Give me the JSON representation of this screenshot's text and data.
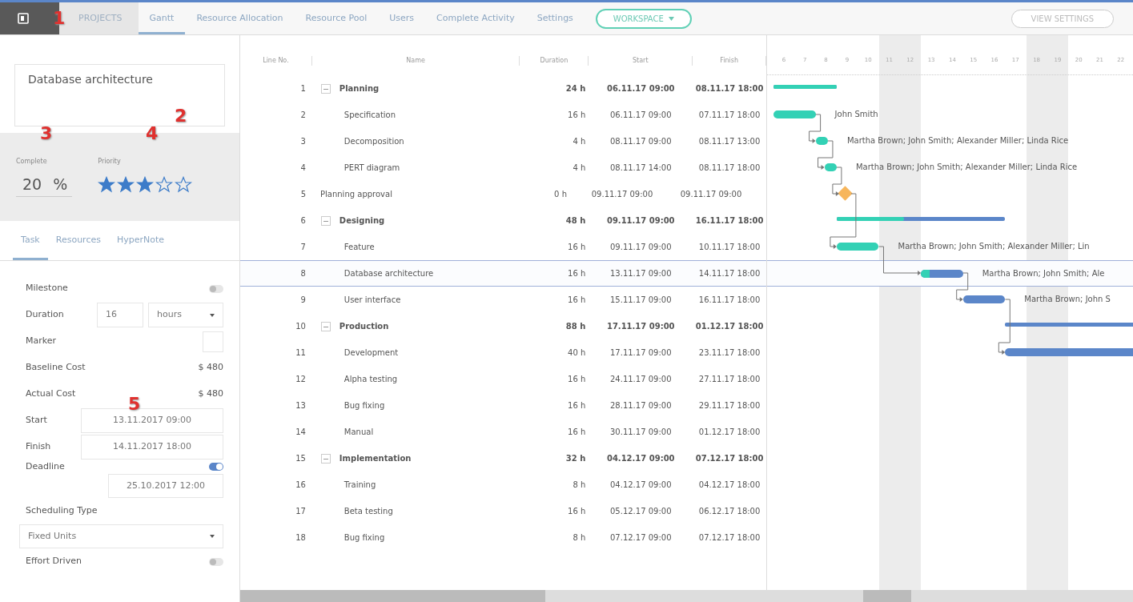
{
  "callouts": [
    "1",
    "2",
    "3",
    "4",
    "5"
  ],
  "topnav": {
    "projects": "PROJECTS",
    "tabs": [
      {
        "label": "Gantt",
        "selected": true
      },
      {
        "label": "Resource Allocation",
        "selected": false
      },
      {
        "label": "Resource Pool",
        "selected": false
      },
      {
        "label": "Users",
        "selected": false
      },
      {
        "label": "Complete Activity",
        "selected": false
      },
      {
        "label": "Settings",
        "selected": false
      }
    ],
    "workspace": "WORKSPACE",
    "view_settings": "VIEW SETTINGS"
  },
  "task_panel": {
    "name": "Database architecture",
    "complete_label": "Complete",
    "complete": "20",
    "percent": "%",
    "priority_label": "Priority",
    "stars": 3,
    "tabs": [
      {
        "label": "Task",
        "selected": true
      },
      {
        "label": "Resources",
        "selected": false
      },
      {
        "label": "HyperNote",
        "selected": false
      }
    ],
    "fields": [
      {
        "kind": "toggle",
        "label": "Milestone",
        "on": false
      },
      {
        "kind": "duration",
        "label": "Duration",
        "value": "16",
        "unit": "hours"
      },
      {
        "kind": "marker",
        "label": "Marker"
      },
      {
        "kind": "text",
        "label": "Baseline Cost",
        "value": "$ 480"
      },
      {
        "kind": "text",
        "label": "Actual Cost",
        "value": "$ 480"
      },
      {
        "kind": "date",
        "label": "Start",
        "value": "13.11.2017 09:00"
      },
      {
        "kind": "date",
        "label": "Finish",
        "value": "14.11.2017 18:00"
      },
      {
        "kind": "deadline",
        "label": "Deadline",
        "on": true,
        "value": "25.10.2017 12:00"
      },
      {
        "kind": "select",
        "label": "Scheduling Type",
        "value": "Fixed Units"
      },
      {
        "kind": "toggle",
        "label": "Effort Driven",
        "on": false
      }
    ]
  },
  "table": {
    "columns": [
      "Line No.",
      "Name",
      "Duration",
      "Start",
      "Finish"
    ],
    "rows": [
      {
        "no": "1",
        "kind": "summary",
        "expanded": true,
        "name": "Planning",
        "duration": "24 h",
        "start": "06.11.17 09:00",
        "finish": "08.11.17 18:00",
        "selected": false,
        "bar": {
          "level": 1
        }
      },
      {
        "no": "2",
        "kind": "task",
        "name": "Specification",
        "duration": "16 h",
        "start": "06.11.17 09:00",
        "finish": "07.11.17 18:00",
        "selected": false,
        "bar": {
          "level": 1,
          "resources": "John Smith"
        }
      },
      {
        "no": "3",
        "kind": "task",
        "name": "Decomposition",
        "duration": "4 h",
        "start": "08.11.17 09:00",
        "finish": "08.11.17 13:00",
        "selected": false,
        "bar": {
          "level": 1,
          "link_in": true,
          "resources": "Martha Brown; John Smith; Alexander Miller; Linda Rice"
        }
      },
      {
        "no": "4",
        "kind": "task",
        "name": "PERT diagram",
        "duration": "4 h",
        "start": "08.11.17 14:00",
        "finish": "08.11.17 18:00",
        "selected": false,
        "bar": {
          "level": 1,
          "link_in": true,
          "resources": "Martha Brown; John Smith; Alexander Miller; Linda Rice"
        }
      },
      {
        "no": "5",
        "kind": "milestone",
        "name": "Planning approval",
        "duration": "0 h",
        "start": "09.11.17 09:00",
        "finish": "09.11.17 09:00",
        "selected": false,
        "bar": {
          "link_in": true
        }
      },
      {
        "no": "6",
        "kind": "summary",
        "expanded": true,
        "name": "Designing",
        "duration": "48 h",
        "start": "09.11.17 09:00",
        "finish": "16.11.17 18:00",
        "selected": false,
        "bar": {
          "level": 0.4
        }
      },
      {
        "no": "7",
        "kind": "task",
        "name": "Feature",
        "duration": "16 h",
        "start": "09.11.17 09:00",
        "finish": "10.11.17 18:00",
        "selected": false,
        "bar": {
          "level": 1,
          "link_in": true,
          "resources": "Martha Brown; John Smith; Alexander Miller; Lin"
        }
      },
      {
        "no": "8",
        "kind": "task",
        "name": "Database architecture",
        "duration": "16 h",
        "start": "13.11.17 09:00",
        "finish": "14.11.17 18:00",
        "selected": true,
        "bar": {
          "level": 0.2,
          "link_in": true,
          "resources": "Martha Brown; John Smith; Ale"
        }
      },
      {
        "no": "9",
        "kind": "task",
        "name": "User interface",
        "duration": "16 h",
        "start": "15.11.17 09:00",
        "finish": "16.11.17 18:00",
        "selected": false,
        "bar": {
          "level": 0,
          "link_in": true,
          "resources": "Martha Brown; John S"
        }
      },
      {
        "no": "10",
        "kind": "summary",
        "expanded": true,
        "name": "Production",
        "duration": "88 h",
        "start": "17.11.17 09:00",
        "finish": "01.12.17 18:00",
        "selected": false,
        "bar": {
          "level": 0
        }
      },
      {
        "no": "11",
        "kind": "task",
        "name": "Development",
        "duration": "40 h",
        "start": "17.11.17 09:00",
        "finish": "23.11.17 18:00",
        "selected": false,
        "bar": {
          "level": 0,
          "link_in": true
        }
      },
      {
        "no": "12",
        "kind": "task",
        "name": "Alpha testing",
        "duration": "16 h",
        "start": "24.11.17 09:00",
        "finish": "27.11.17 18:00",
        "selected": false
      },
      {
        "no": "13",
        "kind": "task",
        "name": "Bug fixing",
        "duration": "16 h",
        "start": "28.11.17 09:00",
        "finish": "29.11.17 18:00",
        "selected": false
      },
      {
        "no": "14",
        "kind": "task",
        "name": "Manual",
        "duration": "16 h",
        "start": "30.11.17 09:00",
        "finish": "01.12.17 18:00",
        "selected": false
      },
      {
        "no": "15",
        "kind": "summary",
        "expanded": true,
        "name": "Implementation",
        "duration": "32 h",
        "start": "04.12.17 09:00",
        "finish": "07.12.17 18:00",
        "selected": false
      },
      {
        "no": "16",
        "kind": "task",
        "name": "Training",
        "duration": "8 h",
        "start": "04.12.17 09:00",
        "finish": "04.12.17 18:00",
        "selected": false
      },
      {
        "no": "17",
        "kind": "task",
        "name": "Beta testing",
        "duration": "16 h",
        "start": "05.12.17 09:00",
        "finish": "06.12.17 18:00",
        "selected": false
      },
      {
        "no": "18",
        "kind": "task",
        "name": "Bug fixing",
        "duration": "8 h",
        "start": "07.12.17 09:00",
        "finish": "07.12.17 18:00",
        "selected": false
      }
    ]
  },
  "timeline": {
    "days": [
      {
        "label": "6",
        "weekend": false
      },
      {
        "label": "7",
        "weekend": false
      },
      {
        "label": "8",
        "weekend": false
      },
      {
        "label": "9",
        "weekend": false
      },
      {
        "label": "10",
        "weekend": false
      },
      {
        "label": "11",
        "weekend": true
      },
      {
        "label": "12",
        "weekend": true
      },
      {
        "label": "13",
        "weekend": false
      },
      {
        "label": "14",
        "weekend": false
      },
      {
        "label": "15",
        "weekend": false
      },
      {
        "label": "16",
        "weekend": false
      },
      {
        "label": "17",
        "weekend": false
      },
      {
        "label": "18",
        "weekend": true
      },
      {
        "label": "19",
        "weekend": true
      },
      {
        "label": "20",
        "weekend": false
      },
      {
        "label": "21",
        "weekend": false
      },
      {
        "label": "22",
        "weekend": false
      }
    ]
  }
}
